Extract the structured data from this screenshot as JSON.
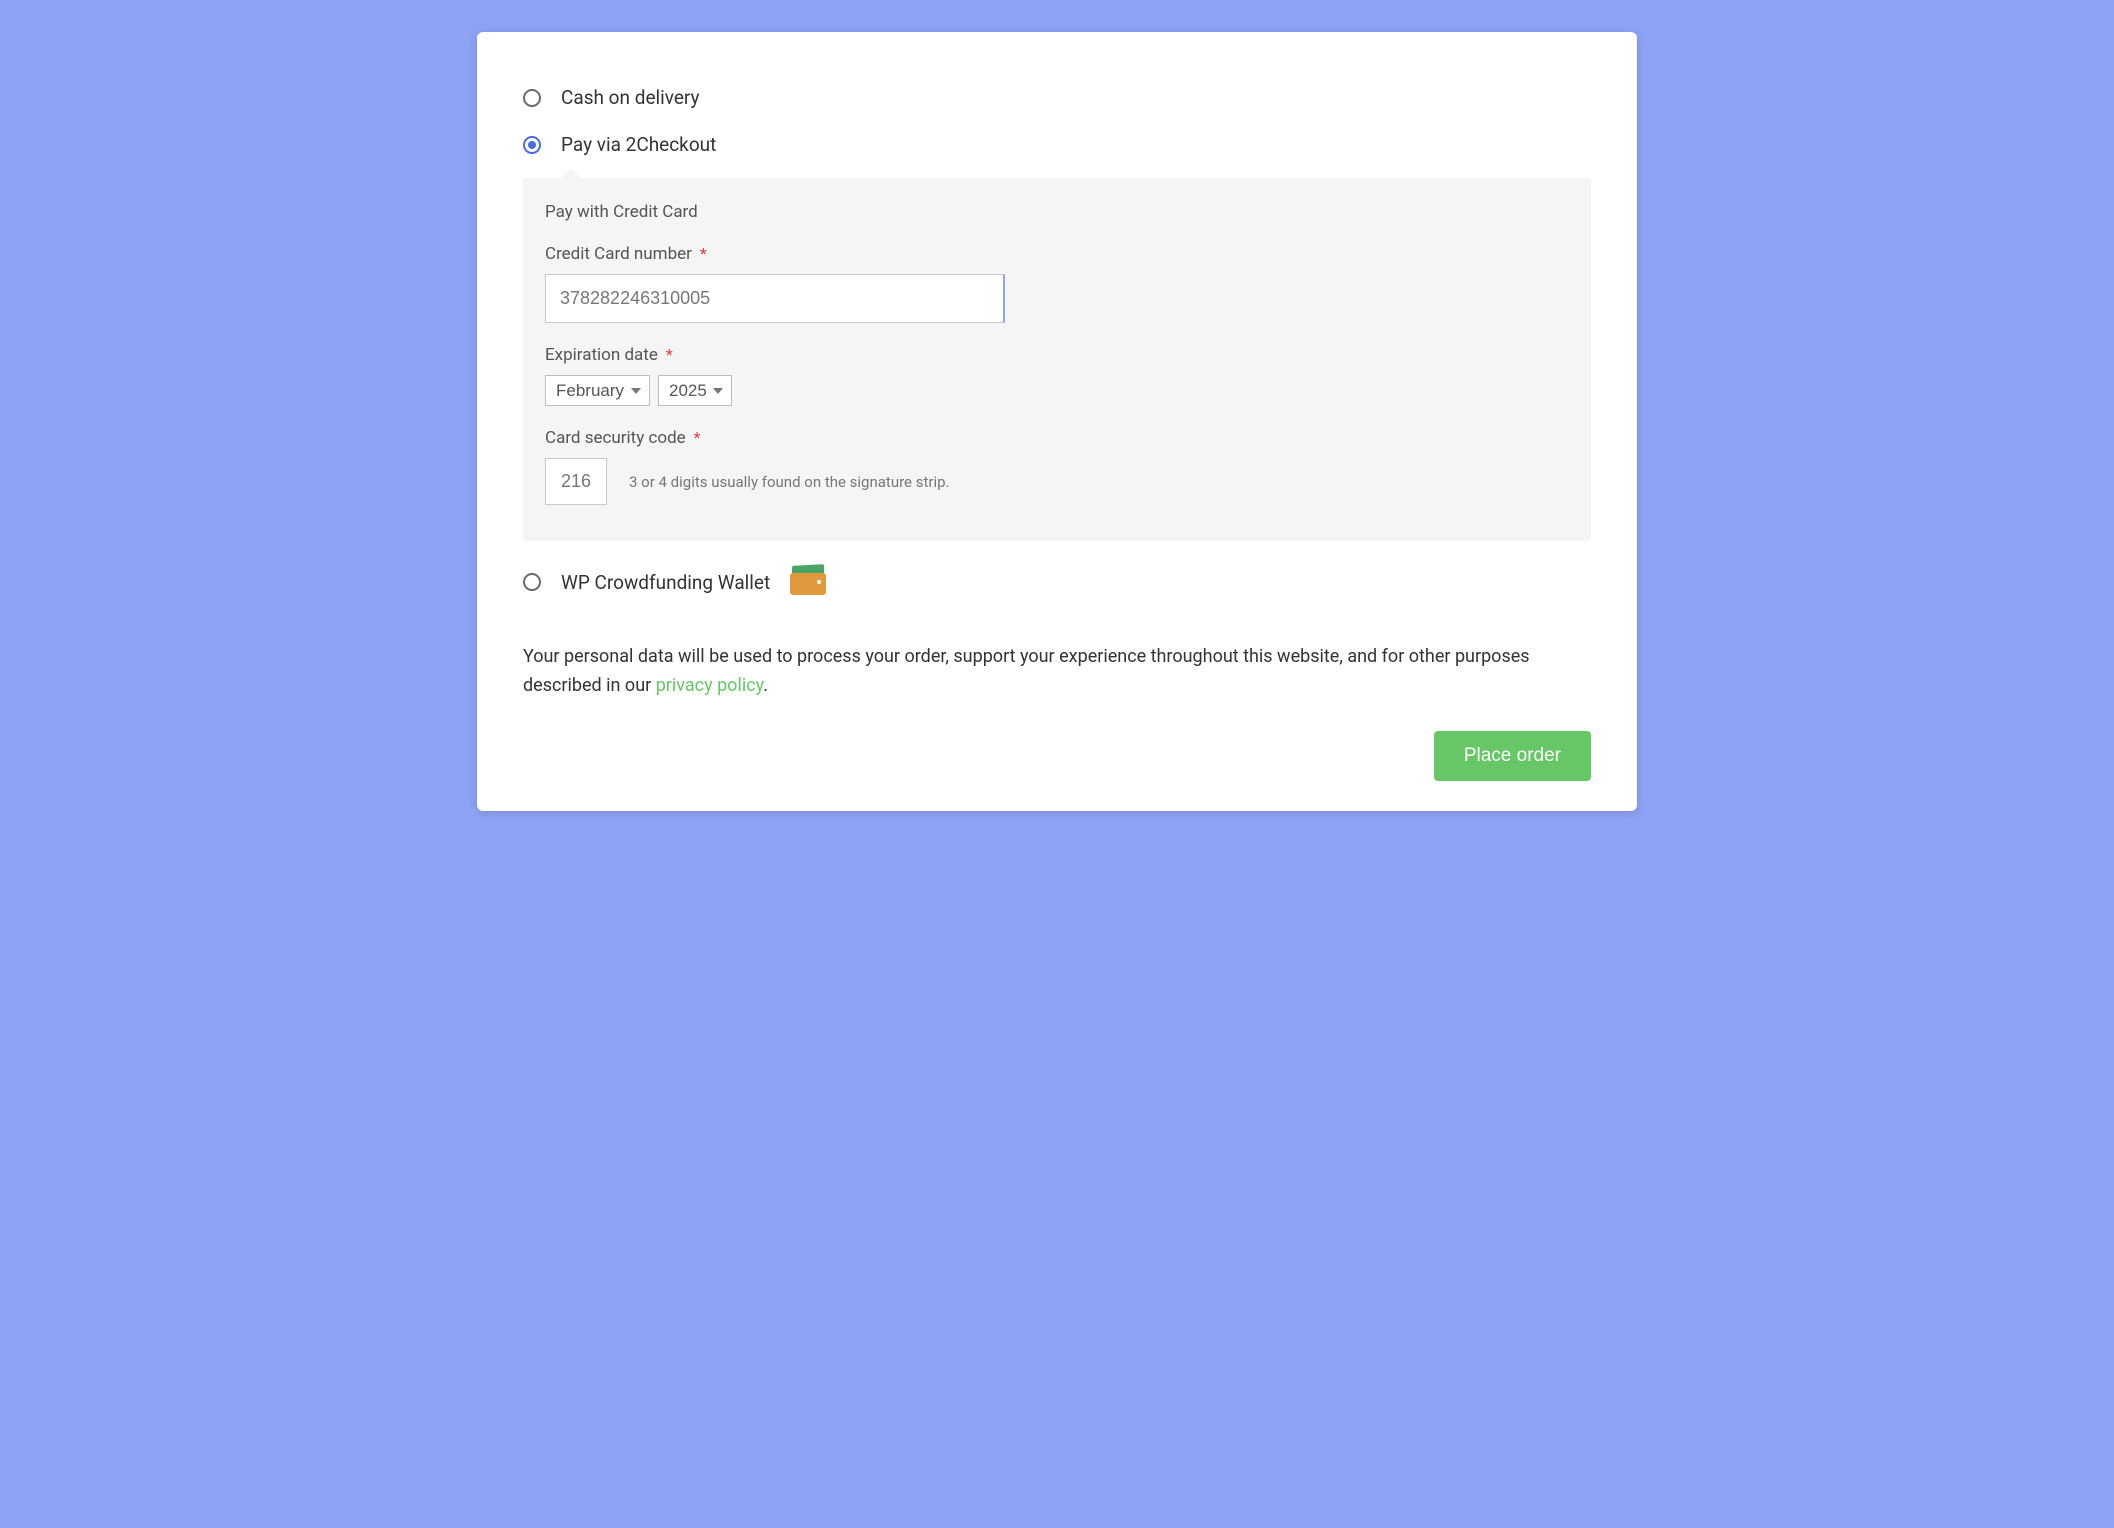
{
  "payment_methods": {
    "cod": {
      "label": "Cash on delivery",
      "selected": false
    },
    "twocheckout": {
      "label": "Pay via 2Checkout",
      "selected": true
    },
    "wallet": {
      "label": "WP Crowdfunding Wallet",
      "selected": false
    }
  },
  "cc_panel": {
    "title": "Pay with Credit Card",
    "number_label": "Credit Card number",
    "number_value": "378282246310005",
    "exp_label": "Expiration date",
    "exp_month": "February",
    "exp_year": "2025",
    "cvc_label": "Card security code",
    "cvc_value": "216",
    "cvc_hint": "3 or 4 digits usually found on the signature strip."
  },
  "privacy": {
    "text_before": "Your personal data will be used to process your order, support your experience throughout this website, and for other purposes described in our ",
    "link_text": "privacy policy",
    "text_after": "."
  },
  "actions": {
    "place_order_label": "Place order"
  }
}
